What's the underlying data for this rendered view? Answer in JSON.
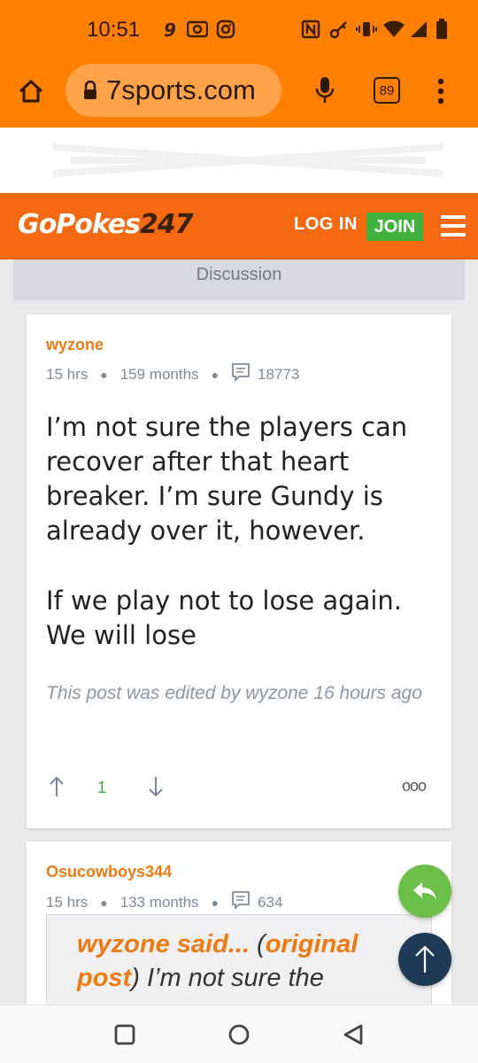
{
  "status_bar": {
    "time": "10:51",
    "left_icons": [
      "notification-9-icon",
      "radio-icon",
      "instagram-icon"
    ],
    "right_icons": [
      "nfc-icon",
      "key-icon",
      "vibrate-icon",
      "wifi-icon",
      "signal-icon",
      "battery-icon"
    ]
  },
  "browser": {
    "url": "7sports.com",
    "tab_count": "89"
  },
  "site": {
    "logo_main": "GoPokes",
    "logo_num": "247",
    "login_label": "LOG IN",
    "join_label": "JOIN",
    "brand_color": "#f56a10",
    "join_color": "#40b33f"
  },
  "discussion": {
    "title": "Discussion"
  },
  "posts": [
    {
      "author": "wyzone",
      "time": "15 hrs",
      "tenure": "159 months",
      "post_count": "18773",
      "body_p1": "I’m not sure the players can recover after that heart breaker. I’m sure Gundy is already over it, however.",
      "body_p2": "If we play not to lose again. We will lose",
      "edited_note": "This post was edited by wyzone 16 hours ago",
      "votes": "1"
    },
    {
      "author": "Osucowboys344",
      "time": "15 hrs",
      "tenure": "133 months",
      "post_count": "634",
      "quote_author": "wyzone said...",
      "quote_open": " (",
      "quote_link": "original post",
      "quote_close": ")",
      "quote_text": " I’m not sure the"
    }
  ],
  "more_label": "ooo"
}
